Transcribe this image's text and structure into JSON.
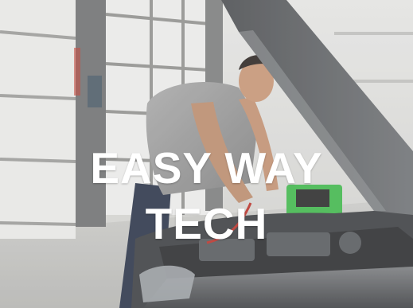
{
  "banner": {
    "title_line1": "EASY WAY",
    "title_line2": "TECH"
  },
  "colors": {
    "title_text": "#ffffff",
    "wall": "#d9d9d6",
    "car_body": "#5a5c5f",
    "diagnostic_tool": "#3fb54a"
  },
  "scene": {
    "description_icon": "mechanic-photo"
  }
}
